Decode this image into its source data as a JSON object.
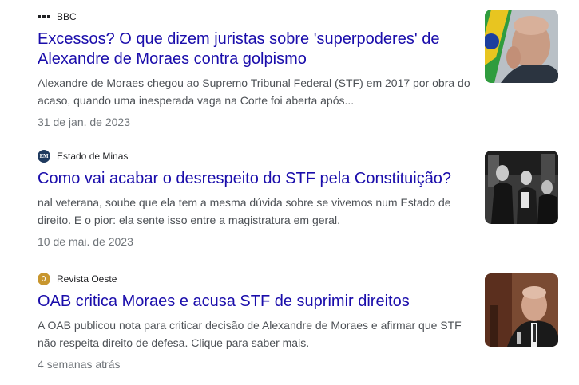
{
  "results": [
    {
      "source": "BBC",
      "title": "Excessos? O que dizem juristas sobre 'superpoderes' de Alexandre de Moraes contra golpismo",
      "snippet": "Alexandre de Moraes chegou ao Supremo Tribunal Federal (STF) em 2017 por obra do acaso, quando uma inesperada vaga na Corte foi aberta após...",
      "date": "31 de jan. de 2023"
    },
    {
      "source": "Estado de Minas",
      "favicon_text": "EM",
      "title": "Como vai acabar o desrespeito do STF pela Constituição?",
      "snippet": "nal veterana, soube que ela tem a mesma dúvida sobre se vivemos num Estado de direito. E o pior: ela sente isso entre a magistratura em geral.",
      "date": "10 de mai. de 2023"
    },
    {
      "source": "Revista Oeste",
      "title": "OAB critica Moraes e acusa STF de suprimir direitos",
      "snippet": "A OAB publicou nota para criticar decisão de Alexandre de Moraes e afirmar que STF não respeita direito de defesa. Clique para saber mais.",
      "date": "4 semanas atrás"
    }
  ],
  "icons": {
    "r1_favicon": "bbc-logo-icon",
    "r2_favicon": "estado-de-minas-logo-icon",
    "r3_favicon": "revista-oeste-logo-icon"
  },
  "colors": {
    "link": "#1a0dab",
    "snippet": "#4d5156",
    "date": "#70757a"
  }
}
